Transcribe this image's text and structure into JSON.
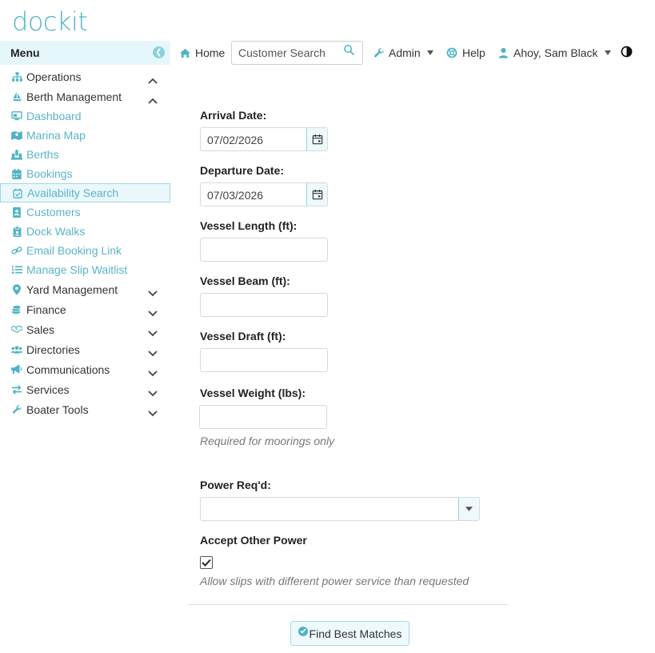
{
  "app": {
    "logo": "dockit"
  },
  "menu": {
    "title": "Menu",
    "items": [
      {
        "label": "Operations",
        "icon": "sitemap-icon",
        "type": "section",
        "expanded": true
      },
      {
        "label": "Berth Management",
        "icon": "sailboat-icon",
        "type": "section",
        "expanded": true
      },
      {
        "label": "Dashboard",
        "icon": "dashboard-icon",
        "type": "sub"
      },
      {
        "label": "Marina Map",
        "icon": "map-icon",
        "type": "sub"
      },
      {
        "label": "Berths",
        "icon": "berths-icon",
        "type": "sub"
      },
      {
        "label": "Bookings",
        "icon": "calendar-icon",
        "type": "sub"
      },
      {
        "label": "Availability Search",
        "icon": "calendar-check-icon",
        "type": "sub",
        "active": true
      },
      {
        "label": "Customers",
        "icon": "address-book-icon",
        "type": "sub"
      },
      {
        "label": "Dock Walks",
        "icon": "clipboard-icon",
        "type": "sub"
      },
      {
        "label": "Email Booking Link",
        "icon": "link-icon",
        "type": "sub"
      },
      {
        "label": "Manage Slip Waitlist",
        "icon": "list-ol-icon",
        "type": "sub"
      },
      {
        "label": "Yard Management",
        "icon": "map-marker-icon",
        "type": "section",
        "expanded": false
      },
      {
        "label": "Finance",
        "icon": "coins-icon",
        "type": "section",
        "expanded": false
      },
      {
        "label": "Sales",
        "icon": "handshake-icon",
        "type": "section",
        "expanded": false
      },
      {
        "label": "Directories",
        "icon": "users-icon",
        "type": "section",
        "expanded": false
      },
      {
        "label": "Communications",
        "icon": "bullhorn-icon",
        "type": "section",
        "expanded": false
      },
      {
        "label": "Services",
        "icon": "exchange-icon",
        "type": "section",
        "expanded": false
      },
      {
        "label": "Boater Tools",
        "icon": "wrench-icon",
        "type": "section",
        "expanded": false
      }
    ]
  },
  "topbar": {
    "home": "Home",
    "search_placeholder": "Customer Search",
    "admin": "Admin",
    "help": "Help",
    "user": "Ahoy, Sam Black"
  },
  "form": {
    "arrival_label": "Arrival Date:",
    "arrival_value": "07/02/2026",
    "departure_label": "Departure Date:",
    "departure_value": "07/03/2026",
    "length_label": "Vessel Length (ft):",
    "beam_label": "Vessel Beam (ft):",
    "draft_label": "Vessel Draft (ft):",
    "weight_label": "Vessel Weight (lbs):",
    "weight_note": "Required for moorings only",
    "power_label": "Power Req'd:",
    "accept_label": "Accept Other Power",
    "accept_checked": true,
    "accept_note": "Allow slips with different power service than requested",
    "submit": "Find Best Matches"
  },
  "colors": {
    "accent": "#4fb3c4",
    "accent_light": "#e6f7fb",
    "link": "#5ab4c8"
  }
}
